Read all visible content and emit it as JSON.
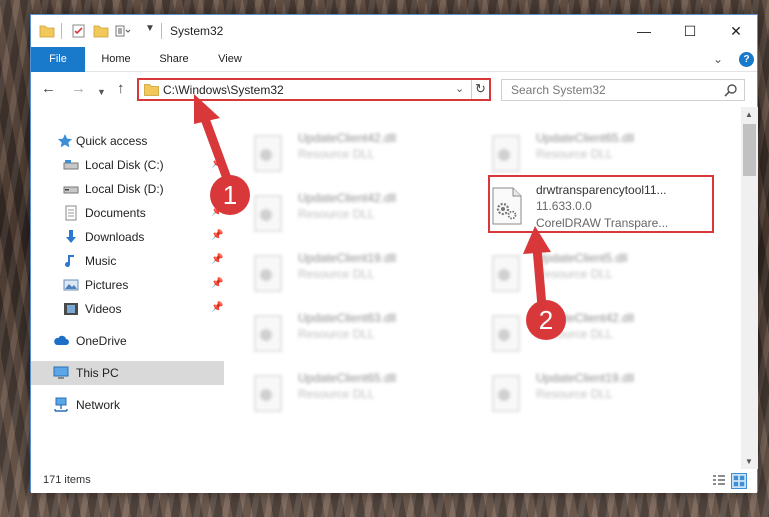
{
  "window": {
    "title": "System32"
  },
  "ribbon": {
    "tabs": [
      {
        "label": "File"
      },
      {
        "label": "Home"
      },
      {
        "label": "Share"
      },
      {
        "label": "View"
      }
    ],
    "help": "?"
  },
  "address": {
    "path": "C:\\Windows\\System32"
  },
  "search": {
    "placeholder": "Search System32"
  },
  "nav_pane": {
    "items": [
      {
        "label": "Quick access",
        "icon": "star-icon",
        "pinned": false
      },
      {
        "label": "Local Disk (C:)",
        "icon": "drive-icon",
        "pinned": true
      },
      {
        "label": "Local Disk (D:)",
        "icon": "drive-icon",
        "pinned": true
      },
      {
        "label": "Documents",
        "icon": "documents-icon",
        "pinned": true
      },
      {
        "label": "Downloads",
        "icon": "download-icon",
        "pinned": true
      },
      {
        "label": "Music",
        "icon": "music-icon",
        "pinned": true
      },
      {
        "label": "Pictures",
        "icon": "pictures-icon",
        "pinned": true
      },
      {
        "label": "Videos",
        "icon": "videos-icon",
        "pinned": true
      },
      {
        "label": "OneDrive",
        "icon": "cloud-icon",
        "pinned": false
      },
      {
        "label": "This PC",
        "icon": "computer-icon",
        "pinned": false,
        "selected": true
      },
      {
        "label": "Network",
        "icon": "network-icon",
        "pinned": false
      }
    ]
  },
  "files": {
    "left_column": [
      {
        "name": "UpdateClient42.dll",
        "type": "Resource DLL"
      },
      {
        "name": "UpdateClient42.dll",
        "type": "Resource DLL"
      },
      {
        "name": "UpdateClient19.dll",
        "type": "Resource DLL"
      },
      {
        "name": "UpdateClient63.dll",
        "type": "Resource DLL"
      },
      {
        "name": "UpdateClient65.dll",
        "type": "Resource DLL"
      }
    ],
    "right_column": [
      {
        "name": "UpdateClient65.dll",
        "type": "Resource DLL"
      },
      {
        "name": "UpdateClient5.dll",
        "type": "Resource DLL"
      },
      {
        "name": "UpdateClient42.dll",
        "type": "Resource DLL"
      },
      {
        "name": "UpdateClient19.dll",
        "type": "Resource DLL"
      }
    ],
    "highlighted": {
      "name": "drwtransparencytool11...",
      "version": "11.633.0.0",
      "description": "CorelDRAW Transpare..."
    }
  },
  "status": {
    "item_count": "171 items"
  },
  "annotations": {
    "step1": "1",
    "step2": "2",
    "color": "#d9383a"
  }
}
